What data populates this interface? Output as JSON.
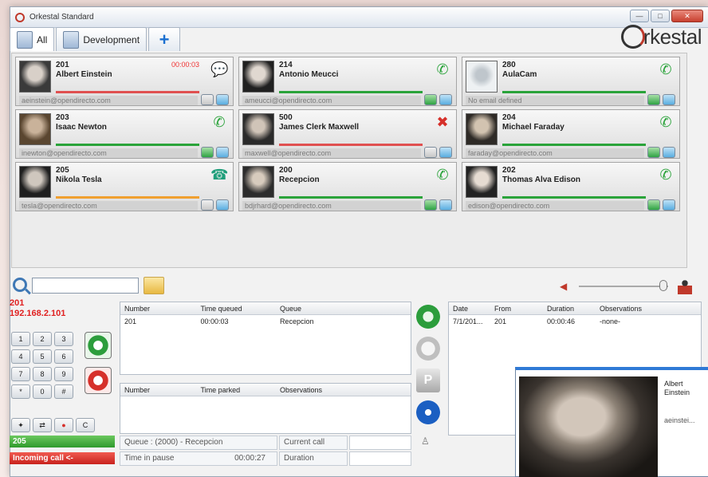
{
  "window": {
    "title": "Orkestal Standard",
    "btn_min": "—",
    "btn_max": "□",
    "btn_close": "✕"
  },
  "tabs": [
    {
      "label": "All"
    },
    {
      "label": "Development"
    },
    {
      "label": "+"
    }
  ],
  "brand": {
    "text": "rkestal"
  },
  "contacts": [
    {
      "ext": "201",
      "name": "Albert Einstein",
      "timer": "00:00:03",
      "status_icon": "chat-bubble",
      "email": "aeinstein@opendirecto.com",
      "line_color": "#e05050"
    },
    {
      "ext": "214",
      "name": "Antonio Meucci",
      "timer": "",
      "status_icon": "phone-green",
      "email": "ameucci@opendirecto.com",
      "line_color": "#2aa33a"
    },
    {
      "ext": "280",
      "name": "AulaCam",
      "timer": "",
      "status_icon": "phone-green",
      "email": "No email defined",
      "line_color": "#2aa33a"
    },
    {
      "ext": "203",
      "name": "Isaac Newton",
      "timer": "",
      "status_icon": "phone-green",
      "email": "inewton@opendirecto.com",
      "line_color": "#2aa33a"
    },
    {
      "ext": "500",
      "name": "James Clerk Maxwell",
      "timer": "",
      "status_icon": "phone-red-x",
      "email": "maxwell@opendirecto.com",
      "line_color": "#e05050"
    },
    {
      "ext": "204",
      "name": "Michael Faraday",
      "timer": "",
      "status_icon": "phone-green",
      "email": "faraday@opendirecto.com",
      "line_color": "#2aa33a"
    },
    {
      "ext": "205",
      "name": "Nikola Tesla",
      "timer": "",
      "status_icon": "phone-ringing",
      "email": "tesla@opendirecto.com",
      "line_color": "#f0a030"
    },
    {
      "ext": "200",
      "name": "Recepcion",
      "timer": "",
      "status_icon": "phone-green",
      "email": "bdjrhard@opendirecto.com",
      "line_color": "#2aa33a"
    },
    {
      "ext": "202",
      "name": "Thomas Alva Edison",
      "timer": "",
      "status_icon": "phone-green",
      "email": "edison@opendirecto.com",
      "line_color": "#2aa33a"
    }
  ],
  "search": {
    "value": "",
    "placeholder": ""
  },
  "volume": {
    "level": 0.95
  },
  "dialpad": {
    "ext": "201",
    "ip": "192.168.2.101",
    "keys": [
      "1",
      "2",
      "3",
      "4",
      "5",
      "6",
      "7",
      "8",
      "9",
      "*",
      "0",
      "#"
    ],
    "clear": "C",
    "status_ext": "205",
    "status_incoming": "Incoming call <-"
  },
  "queued": {
    "headers": [
      "Number",
      "Time queued",
      "Queue"
    ],
    "rows": [
      [
        "201",
        "00:00:03",
        "Recepcion"
      ]
    ]
  },
  "parked": {
    "headers": [
      "Number",
      "Time parked",
      "Observations"
    ],
    "rows": []
  },
  "info": {
    "queue_label": "Queue : (2000) - Recepcion",
    "current_call_label": "Current call",
    "pause_label": "Time in pause",
    "pause_value": "00:00:27",
    "duration_label": "Duration"
  },
  "history": {
    "headers": [
      "Date",
      "From",
      "Duration",
      "Observations"
    ],
    "rows": [
      [
        "7/1/201...",
        "201",
        "00:00:46",
        "-none-"
      ]
    ]
  },
  "popup": {
    "name_line1": "Albert",
    "name_line2": "Einstein",
    "email": "aeinstei..."
  },
  "colors": {
    "accent": "#2f7ad6",
    "call_green": "#2aa33a",
    "hangup_red": "#d6302a"
  }
}
